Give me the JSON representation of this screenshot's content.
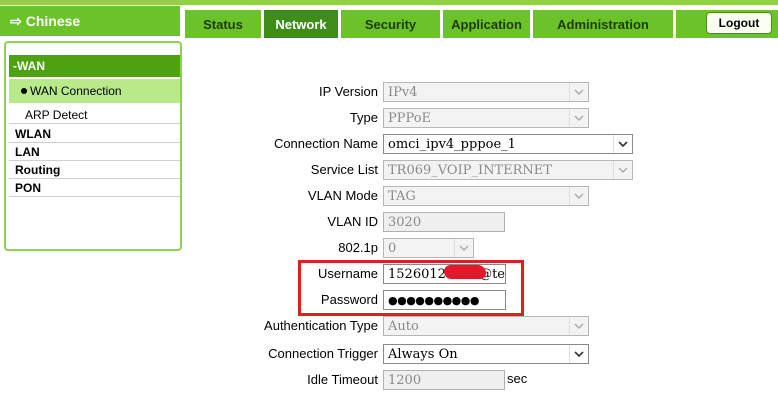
{
  "header": {
    "language": "Chinese",
    "tabs": [
      {
        "label": "Status"
      },
      {
        "label": "Network"
      },
      {
        "label": "Security"
      },
      {
        "label": "Application"
      },
      {
        "label": "Administration"
      }
    ],
    "logout": "Logout"
  },
  "sidebar": {
    "section": "-WAN",
    "selected": "WAN Connection",
    "items": [
      "ARP Detect",
      "WLAN",
      "LAN",
      "Routing",
      "PON"
    ]
  },
  "form": {
    "ip_version": {
      "label": "IP Version",
      "value": "IPv4"
    },
    "type": {
      "label": "Type",
      "value": "PPPoE"
    },
    "connection_name": {
      "label": "Connection Name",
      "value": "omci_ipv4_pppoe_1"
    },
    "service_list": {
      "label": "Service List",
      "value": "TR069_VOIP_INTERNET"
    },
    "vlan_mode": {
      "label": "VLAN Mode",
      "value": "TAG"
    },
    "vlan_id": {
      "label": "VLAN ID",
      "value": "3020"
    },
    "dot1p": {
      "label": "802.1p",
      "value": "0"
    },
    "username": {
      "label": "Username",
      "value_start": "152601260",
      "value_end": "@te"
    },
    "password": {
      "label": "Password",
      "value": "●●●●●●●●●●"
    },
    "auth_type": {
      "label": "Authentication Type",
      "value": "Auto"
    },
    "conn_trigger": {
      "label": "Connection Trigger",
      "value": "Always On"
    },
    "idle_timeout": {
      "label": "Idle Timeout",
      "value": "1200",
      "unit": "sec"
    }
  },
  "icons": {
    "chevron": "chevron-down-icon",
    "arrow": "arrow-right-icon"
  },
  "colors": {
    "brand_green": "#6cc329",
    "active_tab": "#3e8d19",
    "highlight": "#e02020"
  }
}
